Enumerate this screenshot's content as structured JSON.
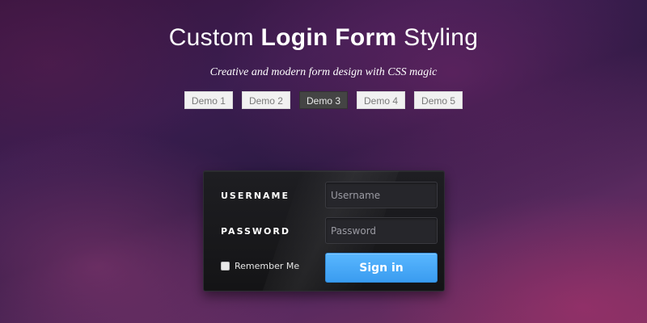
{
  "header": {
    "title_prefix": "Custom ",
    "title_bold": "Login Form",
    "title_suffix": " Styling",
    "subtitle": "Creative and modern form design with CSS magic"
  },
  "demos": [
    {
      "label": "Demo 1",
      "active": false
    },
    {
      "label": "Demo 2",
      "active": false
    },
    {
      "label": "Demo 3",
      "active": true
    },
    {
      "label": "Demo 4",
      "active": false
    },
    {
      "label": "Demo 5",
      "active": false
    }
  ],
  "form": {
    "username_label": "USERNAME",
    "username_placeholder": "Username",
    "username_value": "",
    "password_label": "PASSWORD",
    "password_placeholder": "Password",
    "password_value": "",
    "remember_label": "Remember Me",
    "remember_checked": false,
    "signin_label": "Sign in"
  },
  "colors": {
    "accent": "#3a9cf0",
    "panel": "#1a1a1d",
    "active_demo": "#444444"
  }
}
